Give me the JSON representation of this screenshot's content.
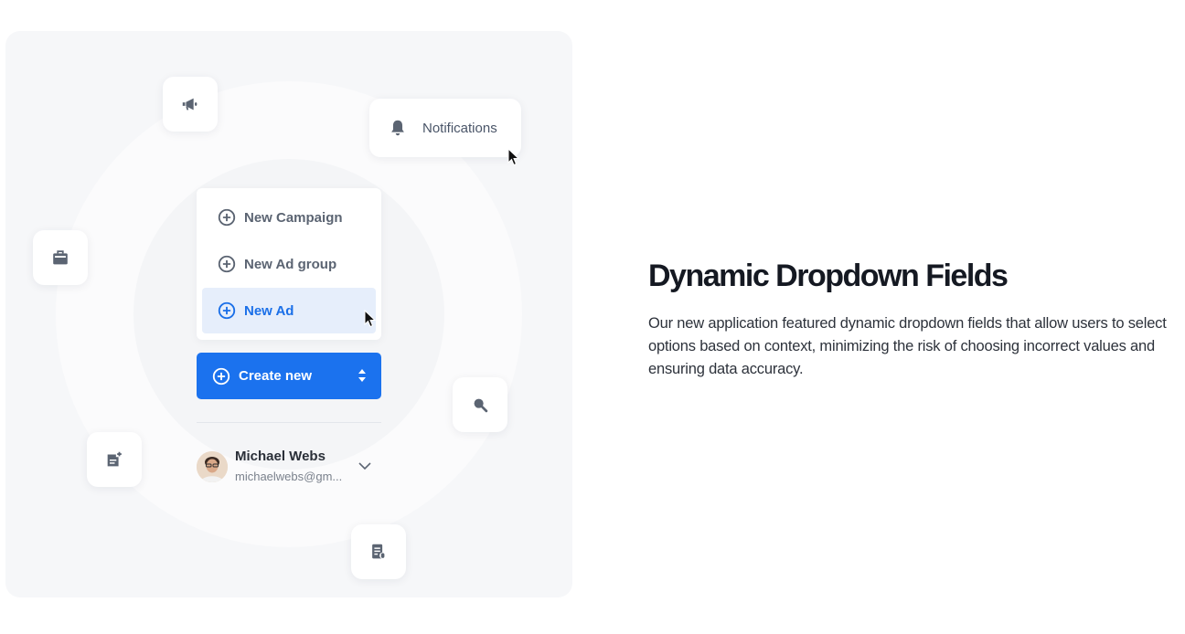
{
  "notifications": {
    "label": "Notifications"
  },
  "dropdown": {
    "items": [
      {
        "label": "New Campaign",
        "active": false
      },
      {
        "label": "New Ad group",
        "active": false
      },
      {
        "label": "New Ad",
        "active": true
      }
    ]
  },
  "create_button": {
    "label": "Create new"
  },
  "user": {
    "name": "Michael Webs",
    "email": "michaelwebs@gm..."
  },
  "feature": {
    "title": "Dynamic Dropdown Fields",
    "description": "Our new application featured dynamic dropdown fields that allow users to select options based on context, minimizing the risk of choosing incorrect values and ensuring data accuracy."
  },
  "icons": [
    "megaphone-icon",
    "bell-icon",
    "briefcase-icon",
    "search-icon",
    "add-post-icon",
    "document-icon",
    "plus-circle-icon",
    "sort-icon",
    "chevron-down-icon",
    "cursor-icon"
  ],
  "colors": {
    "accent": "#1b72ee",
    "active_bg": "#e6eefb",
    "icon_gray": "#5b6472",
    "panel_bg": "#f6f7f9"
  }
}
